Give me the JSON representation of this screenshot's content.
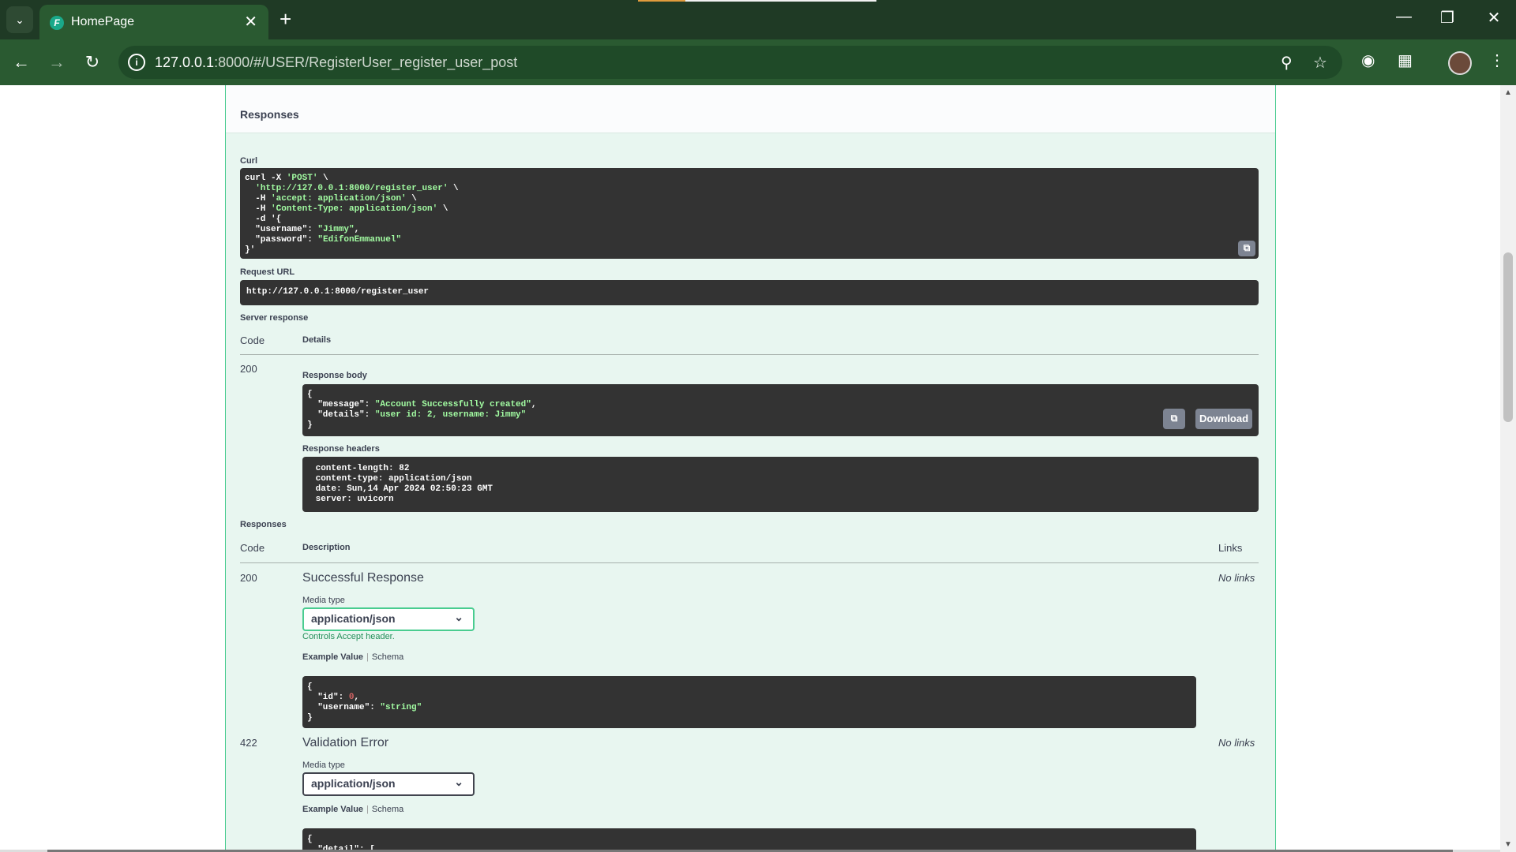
{
  "browser": {
    "tab_title": "HomePage",
    "url_host": "127.0.0.1",
    "url_rest": ":8000/#/USER/RegisterUser_register_user_post"
  },
  "responses_header": "Responses",
  "curl": {
    "label": "Curl",
    "lines": [
      "curl -X 'POST' \\",
      "  'http://127.0.0.1:8000/register_user' \\",
      "  -H 'accept: application/json' \\",
      "  -H 'Content-Type: application/json' \\",
      "  -d '{",
      "  \"username\": \"Jimmy\",",
      "  \"password\": \"EdifonEmmanuel\"",
      "}'"
    ]
  },
  "request_url": {
    "label": "Request URL",
    "value": "http://127.0.0.1:8000/register_user"
  },
  "server_response": {
    "label": "Server response",
    "col_code": "Code",
    "col_details": "Details",
    "code": "200",
    "body_label": "Response body",
    "body_lines": [
      "{",
      "  \"message\": \"Account Successfully created\",",
      "  \"details\": \"user id: 2, username: Jimmy\"",
      "}"
    ],
    "download_label": "Download",
    "headers_label": "Response headers",
    "header_lines": [
      " content-length: 82 ",
      " content-type: application/json ",
      " date: Sun,14 Apr 2024 02:50:23 GMT ",
      " server: uvicorn "
    ]
  },
  "responses": {
    "label": "Responses",
    "col_code": "Code",
    "col_description": "Description",
    "col_links": "Links",
    "items": [
      {
        "code": "200",
        "description": "Successful Response",
        "links": "No links",
        "media_label": "Media type",
        "media_value": "application/json",
        "controls": "Controls Accept header.",
        "example_tab": "Example Value",
        "schema_tab": "Schema",
        "example_lines": [
          "{",
          "  \"id\": 0,",
          "  \"username\": \"string\"",
          "}"
        ]
      },
      {
        "code": "422",
        "description": "Validation Error",
        "links": "No links",
        "media_label": "Media type",
        "media_value": "application/json",
        "example_tab": "Example Value",
        "schema_tab": "Schema",
        "example_lines": [
          "{",
          "  \"detail\": ["
        ]
      }
    ]
  }
}
